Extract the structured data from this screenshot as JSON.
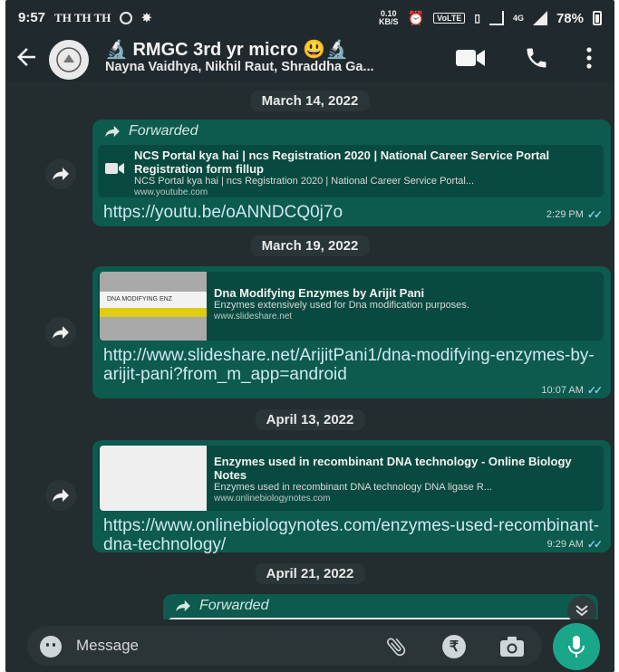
{
  "status_bar": {
    "time": "9:57",
    "carriers": "TH TH TH",
    "net_speed_value": "0.10",
    "net_speed_unit": "KB/S",
    "volte": "VoLTE",
    "lte": "4G",
    "battery": "78%"
  },
  "header": {
    "group_name": "RMGC 3rd yr micro",
    "members": "Nayna Vaidhya, Nikhil Raut, Shraddha Ga..."
  },
  "messages": [
    {
      "date": "March 14, 2022",
      "forwarded_label": "Forwarded",
      "preview_title": "NCS Portal kya hai | ncs Registration 2020 | National Career Service Portal Registration form fillup",
      "preview_desc": "NCS Portal kya hai | ncs Registration 2020 | National Career Service Portal...",
      "preview_site": "www.youtube.com",
      "link": "https://youtu.be/oANNDCQ0j7o",
      "time": "2:29 PM"
    },
    {
      "date": "March 19, 2022",
      "thumb_text": "DNA MODIFYING ENZ",
      "preview_title": "Dna Modifying Enzymes by Arijit Pani",
      "preview_desc": "Enzymes extensively used for Dna modification purposes.",
      "preview_site": "www.slideshare.net",
      "link": "http://www.slideshare.net/ArijitPani1/dna-modifying-enzymes-by-arijit-pani?from_m_app=android",
      "time": "10:07 AM"
    },
    {
      "date": "April 13, 2022",
      "preview_title": "Enzymes used in recombinant DNA technology - Online Biology Notes",
      "preview_desc": "Enzymes used in recombinant DNA technology DNA ligase R...",
      "preview_site": "www.onlinebiologynotes.com",
      "link": "https://www.onlinebiologynotes.com/enzymes-used-recombinant-dna-technology/",
      "time": "9:29 AM"
    },
    {
      "date": "April 21, 2022",
      "forwarded_label": "Forwarded"
    }
  ],
  "input": {
    "placeholder": "Message",
    "pay_symbol": "₹"
  },
  "colors": {
    "chat_bg": "#232c2f",
    "bubble": "#0d5a4e",
    "accent": "#1aa688",
    "link": "#cfe9f2",
    "read_ticks": "#7ec7ea"
  },
  "icons": [
    "back-arrow-icon",
    "video-call-icon",
    "phone-icon",
    "more-vert-icon",
    "forward-icon",
    "video-play-icon",
    "emoji-icon",
    "attach-icon",
    "rupee-icon",
    "camera-icon",
    "mic-icon",
    "double-chevron-down-icon",
    "double-tick-icon"
  ]
}
